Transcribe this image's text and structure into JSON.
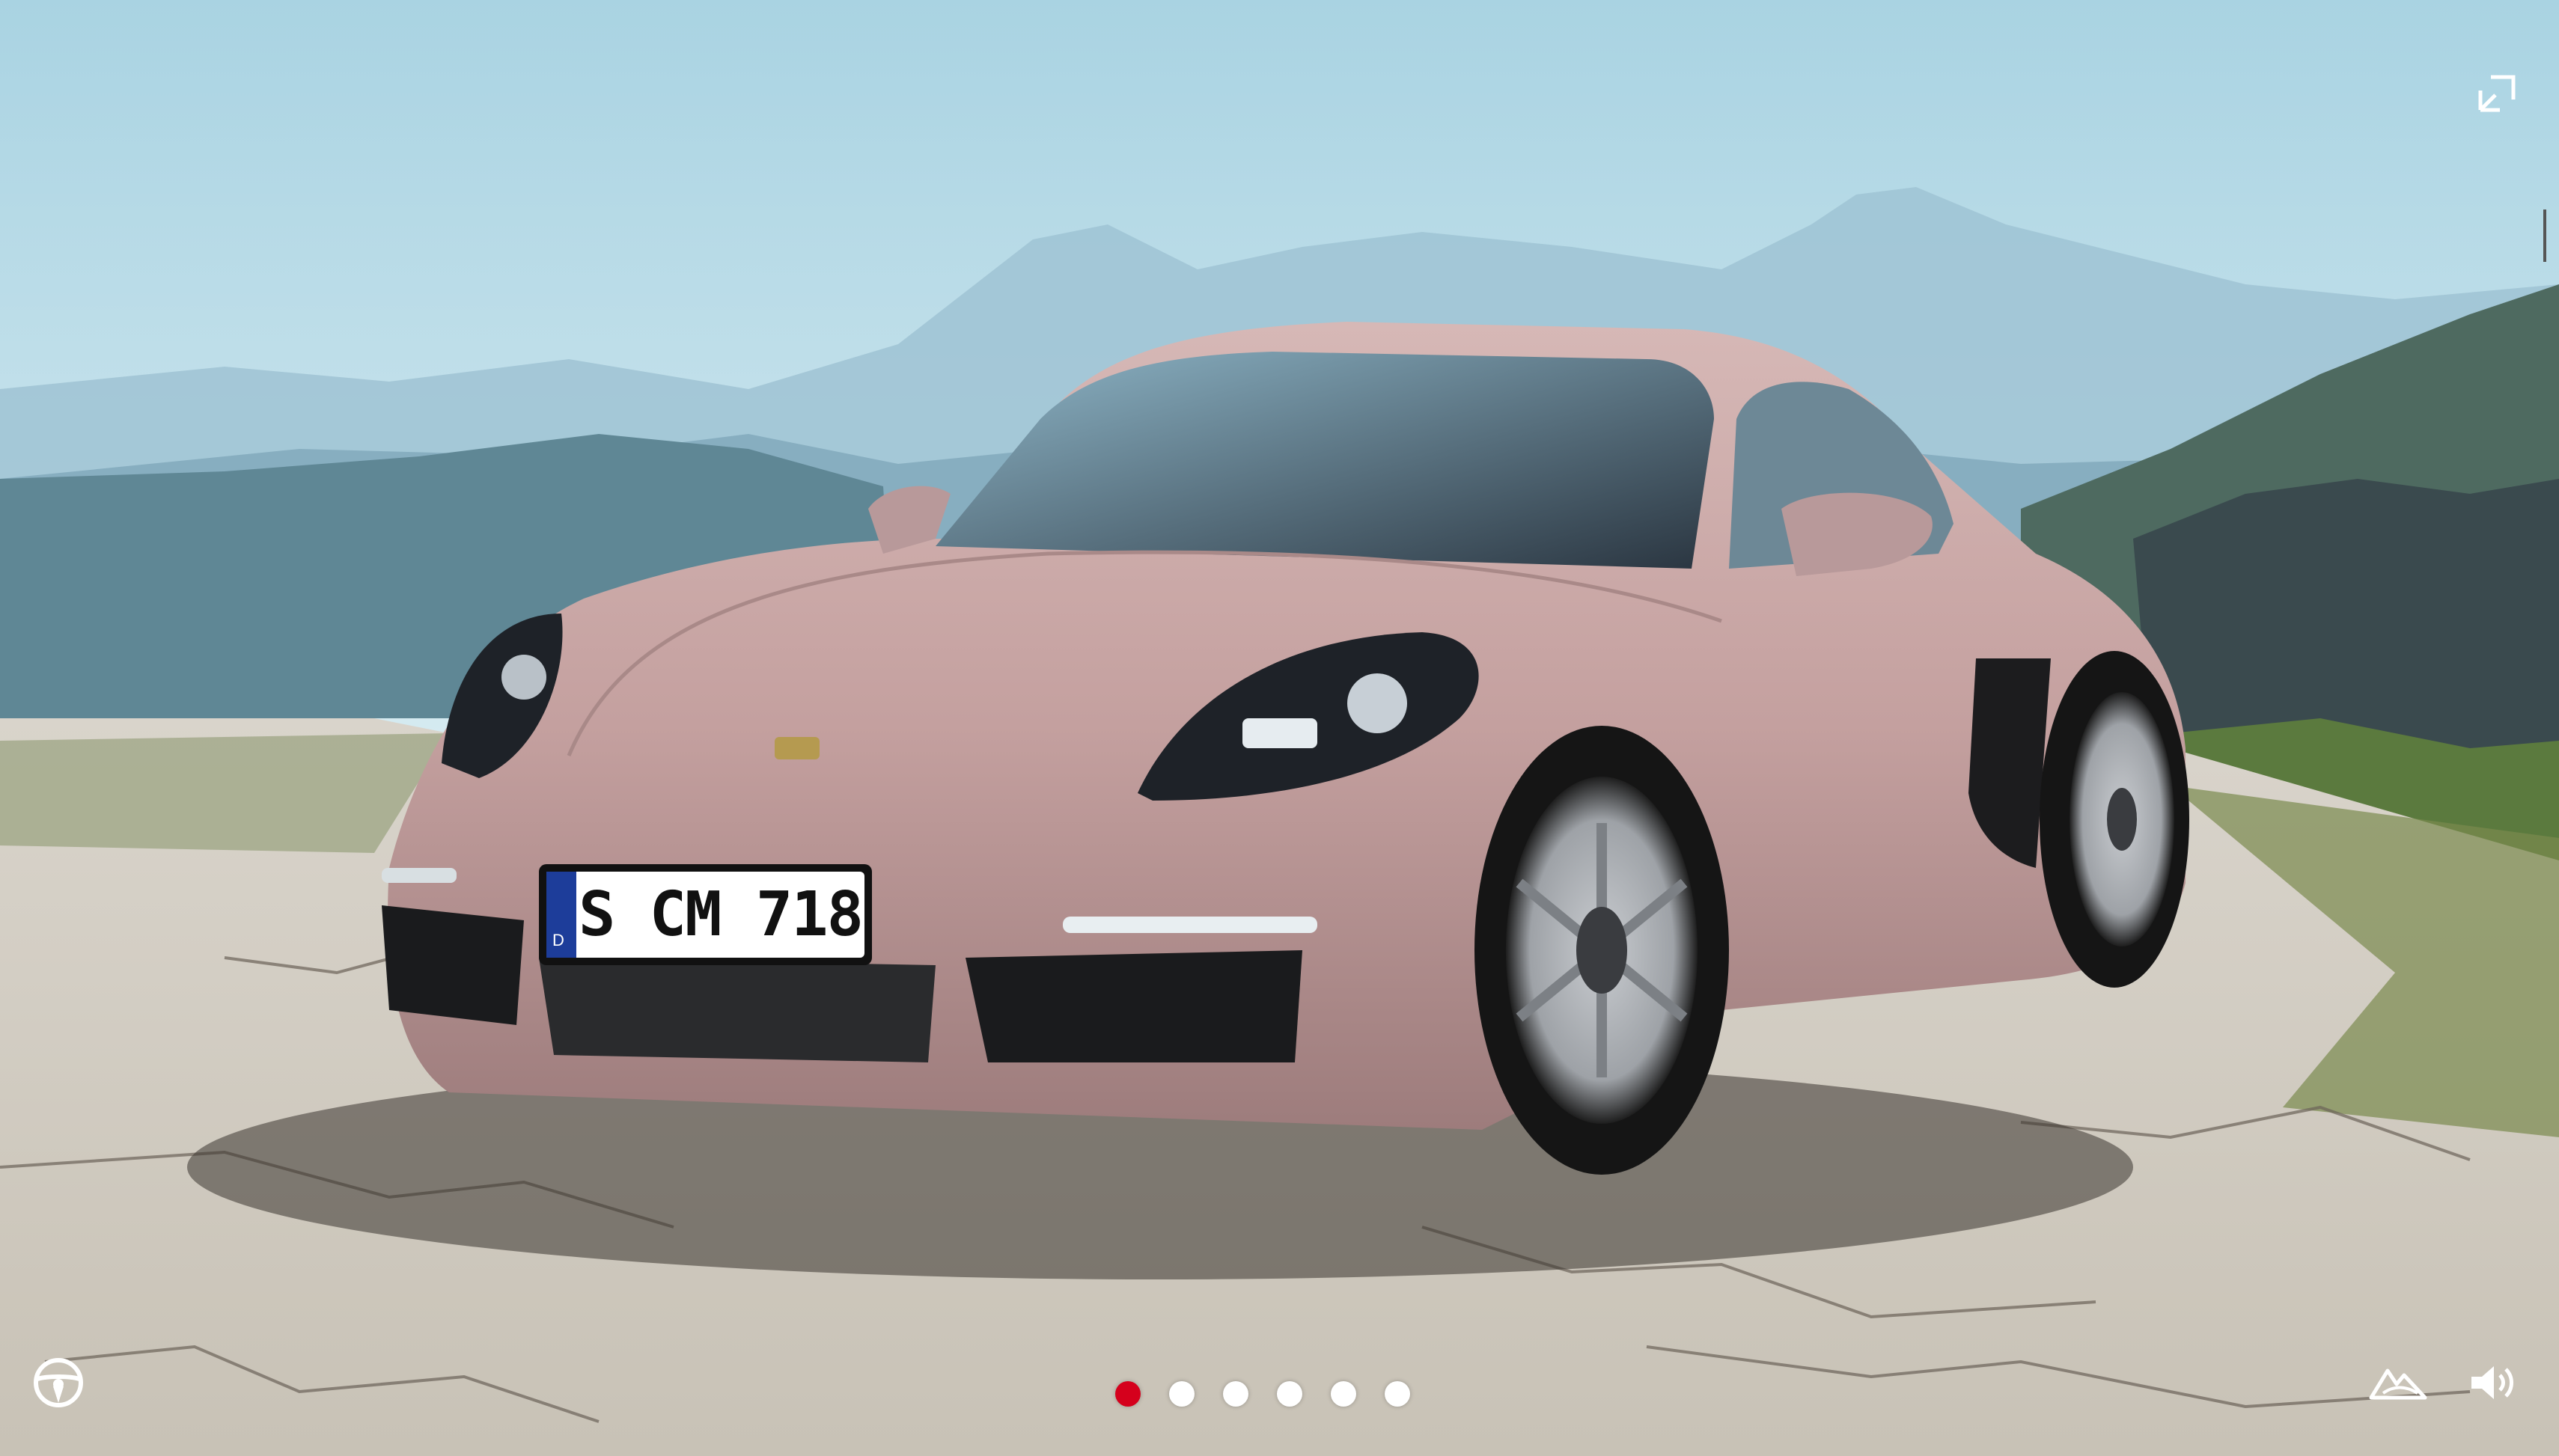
{
  "viewer": {
    "license_plate": {
      "country_code": "D",
      "text": "S CM 718"
    },
    "gallery": {
      "slide_count": 6,
      "active_slide": 1
    },
    "controls": {
      "fullscreen": "expand-icon",
      "steering": "steering-wheel-icon",
      "environment": "landscape-icon",
      "sound": "speaker-icon"
    },
    "colors": {
      "active_dot": "#d5001c",
      "inactive_dot": "#ffffff",
      "car_paint": "#c9a7a5"
    }
  }
}
